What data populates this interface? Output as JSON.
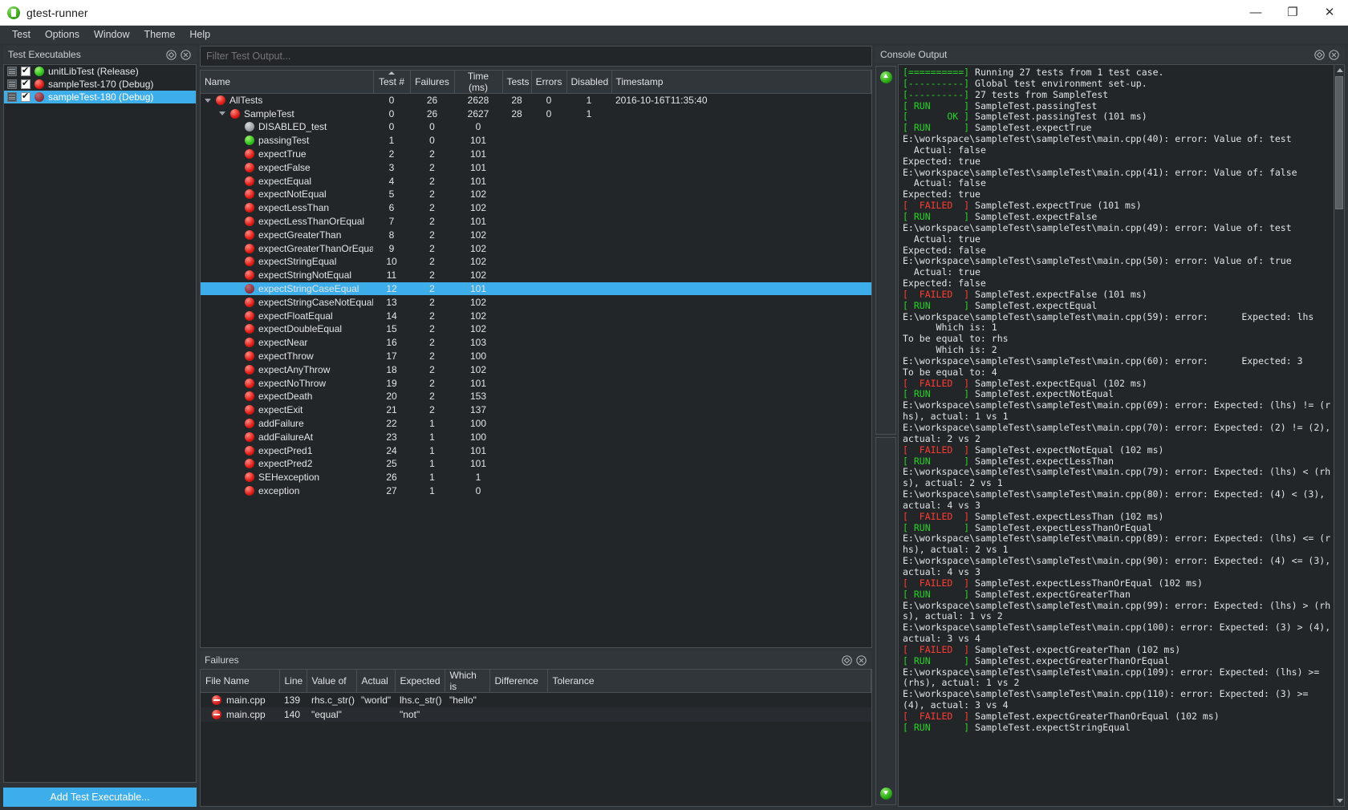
{
  "window": {
    "title": "gtest-runner",
    "app_icon": "gtest-runner-icon",
    "minimize": "—",
    "maximize": "❐",
    "close": "✕"
  },
  "menubar": {
    "items": [
      "Test",
      "Options",
      "Window",
      "Theme",
      "Help"
    ]
  },
  "test_executables": {
    "title": "Test Executables",
    "float_icon": "float-icon",
    "close_icon": "close-icon",
    "items": [
      {
        "name": "unitLibTest (Release)",
        "checked": true,
        "status": "green",
        "selected": false
      },
      {
        "name": "sampleTest-170 (Debug)",
        "checked": true,
        "status": "red",
        "selected": false
      },
      {
        "name": "sampleTest-180 (Debug)",
        "checked": true,
        "status": "dark-red",
        "selected": true
      }
    ],
    "add_button": "Add Test Executable..."
  },
  "filter": {
    "placeholder": "Filter Test Output...",
    "value": ""
  },
  "tests_tree": {
    "columns": [
      "Name",
      "Test #",
      "Failures",
      "Time (ms)",
      "Tests",
      "Errors",
      "Disabled",
      "Timestamp"
    ],
    "sorted_column": "Test #",
    "rows": [
      {
        "name": "AllTests",
        "indent": 0,
        "arrow": "open",
        "status": "red",
        "test_num": "0",
        "failures": "26",
        "time": "2628",
        "tests": "28",
        "errors": "0",
        "disabled": "1",
        "timestamp": "2016-10-16T11:35:40",
        "selected": false
      },
      {
        "name": "SampleTest",
        "indent": 1,
        "arrow": "open",
        "status": "red",
        "test_num": "0",
        "failures": "26",
        "time": "2627",
        "tests": "28",
        "errors": "0",
        "disabled": "1",
        "timestamp": "",
        "selected": false
      },
      {
        "name": "DISABLED_test",
        "indent": 2,
        "arrow": "none",
        "status": "grey",
        "test_num": "0",
        "failures": "0",
        "time": "0",
        "tests": "",
        "errors": "",
        "disabled": "",
        "timestamp": "",
        "selected": false
      },
      {
        "name": "passingTest",
        "indent": 2,
        "arrow": "none",
        "status": "green",
        "test_num": "1",
        "failures": "0",
        "time": "101",
        "tests": "",
        "errors": "",
        "disabled": "",
        "timestamp": "",
        "selected": false
      },
      {
        "name": "expectTrue",
        "indent": 2,
        "arrow": "none",
        "status": "red",
        "test_num": "2",
        "failures": "2",
        "time": "101",
        "tests": "",
        "errors": "",
        "disabled": "",
        "timestamp": "",
        "selected": false
      },
      {
        "name": "expectFalse",
        "indent": 2,
        "arrow": "none",
        "status": "red",
        "test_num": "3",
        "failures": "2",
        "time": "101",
        "tests": "",
        "errors": "",
        "disabled": "",
        "timestamp": "",
        "selected": false
      },
      {
        "name": "expectEqual",
        "indent": 2,
        "arrow": "none",
        "status": "red",
        "test_num": "4",
        "failures": "2",
        "time": "101",
        "tests": "",
        "errors": "",
        "disabled": "",
        "timestamp": "",
        "selected": false
      },
      {
        "name": "expectNotEqual",
        "indent": 2,
        "arrow": "none",
        "status": "red",
        "test_num": "5",
        "failures": "2",
        "time": "102",
        "tests": "",
        "errors": "",
        "disabled": "",
        "timestamp": "",
        "selected": false
      },
      {
        "name": "expectLessThan",
        "indent": 2,
        "arrow": "none",
        "status": "red",
        "test_num": "6",
        "failures": "2",
        "time": "102",
        "tests": "",
        "errors": "",
        "disabled": "",
        "timestamp": "",
        "selected": false
      },
      {
        "name": "expectLessThanOrEqual",
        "indent": 2,
        "arrow": "none",
        "status": "red",
        "test_num": "7",
        "failures": "2",
        "time": "101",
        "tests": "",
        "errors": "",
        "disabled": "",
        "timestamp": "",
        "selected": false
      },
      {
        "name": "expectGreaterThan",
        "indent": 2,
        "arrow": "none",
        "status": "red",
        "test_num": "8",
        "failures": "2",
        "time": "102",
        "tests": "",
        "errors": "",
        "disabled": "",
        "timestamp": "",
        "selected": false
      },
      {
        "name": "expectGreaterThanOrEqual",
        "indent": 2,
        "arrow": "none",
        "status": "red",
        "test_num": "9",
        "failures": "2",
        "time": "102",
        "tests": "",
        "errors": "",
        "disabled": "",
        "timestamp": "",
        "selected": false
      },
      {
        "name": "expectStringEqual",
        "indent": 2,
        "arrow": "none",
        "status": "red",
        "test_num": "10",
        "failures": "2",
        "time": "102",
        "tests": "",
        "errors": "",
        "disabled": "",
        "timestamp": "",
        "selected": false
      },
      {
        "name": "expectStringNotEqual",
        "indent": 2,
        "arrow": "none",
        "status": "red",
        "test_num": "11",
        "failures": "2",
        "time": "102",
        "tests": "",
        "errors": "",
        "disabled": "",
        "timestamp": "",
        "selected": false
      },
      {
        "name": "expectStringCaseEqual",
        "indent": 2,
        "arrow": "none",
        "status": "dark-red",
        "test_num": "12",
        "failures": "2",
        "time": "101",
        "tests": "",
        "errors": "",
        "disabled": "",
        "timestamp": "",
        "selected": true
      },
      {
        "name": "expectStringCaseNotEqual",
        "indent": 2,
        "arrow": "none",
        "status": "red",
        "test_num": "13",
        "failures": "2",
        "time": "102",
        "tests": "",
        "errors": "",
        "disabled": "",
        "timestamp": "",
        "selected": false
      },
      {
        "name": "expectFloatEqual",
        "indent": 2,
        "arrow": "none",
        "status": "red",
        "test_num": "14",
        "failures": "2",
        "time": "102",
        "tests": "",
        "errors": "",
        "disabled": "",
        "timestamp": "",
        "selected": false
      },
      {
        "name": "expectDoubleEqual",
        "indent": 2,
        "arrow": "none",
        "status": "red",
        "test_num": "15",
        "failures": "2",
        "time": "102",
        "tests": "",
        "errors": "",
        "disabled": "",
        "timestamp": "",
        "selected": false
      },
      {
        "name": "expectNear",
        "indent": 2,
        "arrow": "none",
        "status": "red",
        "test_num": "16",
        "failures": "2",
        "time": "103",
        "tests": "",
        "errors": "",
        "disabled": "",
        "timestamp": "",
        "selected": false
      },
      {
        "name": "expectThrow",
        "indent": 2,
        "arrow": "none",
        "status": "red",
        "test_num": "17",
        "failures": "2",
        "time": "100",
        "tests": "",
        "errors": "",
        "disabled": "",
        "timestamp": "",
        "selected": false
      },
      {
        "name": "expectAnyThrow",
        "indent": 2,
        "arrow": "none",
        "status": "red",
        "test_num": "18",
        "failures": "2",
        "time": "102",
        "tests": "",
        "errors": "",
        "disabled": "",
        "timestamp": "",
        "selected": false
      },
      {
        "name": "expectNoThrow",
        "indent": 2,
        "arrow": "none",
        "status": "red",
        "test_num": "19",
        "failures": "2",
        "time": "101",
        "tests": "",
        "errors": "",
        "disabled": "",
        "timestamp": "",
        "selected": false
      },
      {
        "name": "expectDeath",
        "indent": 2,
        "arrow": "none",
        "status": "red",
        "test_num": "20",
        "failures": "2",
        "time": "153",
        "tests": "",
        "errors": "",
        "disabled": "",
        "timestamp": "",
        "selected": false
      },
      {
        "name": "expectExit",
        "indent": 2,
        "arrow": "none",
        "status": "red",
        "test_num": "21",
        "failures": "2",
        "time": "137",
        "tests": "",
        "errors": "",
        "disabled": "",
        "timestamp": "",
        "selected": false
      },
      {
        "name": "addFailure",
        "indent": 2,
        "arrow": "none",
        "status": "red",
        "test_num": "22",
        "failures": "1",
        "time": "100",
        "tests": "",
        "errors": "",
        "disabled": "",
        "timestamp": "",
        "selected": false
      },
      {
        "name": "addFailureAt",
        "indent": 2,
        "arrow": "none",
        "status": "red",
        "test_num": "23",
        "failures": "1",
        "time": "100",
        "tests": "",
        "errors": "",
        "disabled": "",
        "timestamp": "",
        "selected": false
      },
      {
        "name": "expectPred1",
        "indent": 2,
        "arrow": "none",
        "status": "red",
        "test_num": "24",
        "failures": "1",
        "time": "101",
        "tests": "",
        "errors": "",
        "disabled": "",
        "timestamp": "",
        "selected": false
      },
      {
        "name": "expectPred2",
        "indent": 2,
        "arrow": "none",
        "status": "red",
        "test_num": "25",
        "failures": "1",
        "time": "101",
        "tests": "",
        "errors": "",
        "disabled": "",
        "timestamp": "",
        "selected": false
      },
      {
        "name": "SEHexception",
        "indent": 2,
        "arrow": "none",
        "status": "red",
        "test_num": "26",
        "failures": "1",
        "time": "1",
        "tests": "",
        "errors": "",
        "disabled": "",
        "timestamp": "",
        "selected": false
      },
      {
        "name": "exception",
        "indent": 2,
        "arrow": "none",
        "status": "red",
        "test_num": "27",
        "failures": "1",
        "time": "0",
        "tests": "",
        "errors": "",
        "disabled": "",
        "timestamp": "",
        "selected": false
      }
    ]
  },
  "failures": {
    "title": "Failures",
    "float_icon": "float-icon",
    "close_icon": "close-icon",
    "columns": [
      "File Name",
      "Line",
      "Value of",
      "Actual",
      "Expected",
      "Which is",
      "Difference",
      "Tolerance"
    ],
    "sorted_column": "File Name",
    "rows": [
      {
        "file": "main.cpp",
        "line": "139",
        "value_of": "rhs.c_str()",
        "actual": "\"world\"",
        "expected": "lhs.c_str()",
        "which_is": "\"hello\"",
        "difference": "",
        "tolerance": ""
      },
      {
        "file": "main.cpp",
        "line": "140",
        "value_of": "\"equal\"",
        "actual": "",
        "expected": "\"not\"",
        "which_is": "",
        "difference": "",
        "tolerance": ""
      }
    ]
  },
  "console": {
    "title": "Console Output",
    "float_icon": "float-icon",
    "close_icon": "close-icon",
    "prev_failure_icon": "arrow-up-icon",
    "next_failure_icon": "arrow-down-icon",
    "scroll_up_icon": "scroll-up-icon",
    "scroll_down_icon": "scroll-down-icon",
    "lines": [
      {
        "tag": "[==========]",
        "tag_color": "green",
        "text": " Running 27 tests from 1 test case."
      },
      {
        "tag": "[----------]",
        "tag_color": "green",
        "text": " Global test environment set-up."
      },
      {
        "tag": "[----------]",
        "tag_color": "green",
        "text": " 27 tests from SampleTest"
      },
      {
        "tag": "[ RUN      ]",
        "tag_color": "green",
        "text": " SampleTest.passingTest"
      },
      {
        "tag": "[       OK ]",
        "tag_color": "green",
        "text": " SampleTest.passingTest (101 ms)"
      },
      {
        "tag": "[ RUN      ]",
        "tag_color": "green",
        "text": " SampleTest.expectTrue"
      },
      {
        "tag": "",
        "tag_color": "",
        "text": "E:\\workspace\\sampleTest\\sampleTest\\main.cpp(40): error: Value of: test"
      },
      {
        "tag": "",
        "tag_color": "",
        "text": "  Actual: false"
      },
      {
        "tag": "",
        "tag_color": "",
        "text": "Expected: true"
      },
      {
        "tag": "",
        "tag_color": "",
        "text": "E:\\workspace\\sampleTest\\sampleTest\\main.cpp(41): error: Value of: false"
      },
      {
        "tag": "",
        "tag_color": "",
        "text": "  Actual: false"
      },
      {
        "tag": "",
        "tag_color": "",
        "text": "Expected: true"
      },
      {
        "tag": "[  FAILED  ]",
        "tag_color": "red",
        "text": " SampleTest.expectTrue (101 ms)"
      },
      {
        "tag": "[ RUN      ]",
        "tag_color": "green",
        "text": " SampleTest.expectFalse"
      },
      {
        "tag": "",
        "tag_color": "",
        "text": "E:\\workspace\\sampleTest\\sampleTest\\main.cpp(49): error: Value of: test"
      },
      {
        "tag": "",
        "tag_color": "",
        "text": "  Actual: true"
      },
      {
        "tag": "",
        "tag_color": "",
        "text": "Expected: false"
      },
      {
        "tag": "",
        "tag_color": "",
        "text": "E:\\workspace\\sampleTest\\sampleTest\\main.cpp(50): error: Value of: true"
      },
      {
        "tag": "",
        "tag_color": "",
        "text": "  Actual: true"
      },
      {
        "tag": "",
        "tag_color": "",
        "text": "Expected: false"
      },
      {
        "tag": "[  FAILED  ]",
        "tag_color": "red",
        "text": " SampleTest.expectFalse (101 ms)"
      },
      {
        "tag": "[ RUN      ]",
        "tag_color": "green",
        "text": " SampleTest.expectEqual"
      },
      {
        "tag": "",
        "tag_color": "",
        "text": "E:\\workspace\\sampleTest\\sampleTest\\main.cpp(59): error:      Expected: lhs"
      },
      {
        "tag": "",
        "tag_color": "",
        "text": "      Which is: 1"
      },
      {
        "tag": "",
        "tag_color": "",
        "text": "To be equal to: rhs"
      },
      {
        "tag": "",
        "tag_color": "",
        "text": "      Which is: 2"
      },
      {
        "tag": "",
        "tag_color": "",
        "text": "E:\\workspace\\sampleTest\\sampleTest\\main.cpp(60): error:      Expected: 3"
      },
      {
        "tag": "",
        "tag_color": "",
        "text": "To be equal to: 4"
      },
      {
        "tag": "[  FAILED  ]",
        "tag_color": "red",
        "text": " SampleTest.expectEqual (102 ms)"
      },
      {
        "tag": "[ RUN      ]",
        "tag_color": "green",
        "text": " SampleTest.expectNotEqual"
      },
      {
        "tag": "",
        "tag_color": "",
        "text": "E:\\workspace\\sampleTest\\sampleTest\\main.cpp(69): error: Expected: (lhs) != (rhs), actual: 1 vs 1"
      },
      {
        "tag": "",
        "tag_color": "",
        "text": "E:\\workspace\\sampleTest\\sampleTest\\main.cpp(70): error: Expected: (2) != (2), actual: 2 vs 2"
      },
      {
        "tag": "[  FAILED  ]",
        "tag_color": "red",
        "text": " SampleTest.expectNotEqual (102 ms)"
      },
      {
        "tag": "[ RUN      ]",
        "tag_color": "green",
        "text": " SampleTest.expectLessThan"
      },
      {
        "tag": "",
        "tag_color": "",
        "text": "E:\\workspace\\sampleTest\\sampleTest\\main.cpp(79): error: Expected: (lhs) < (rhs), actual: 2 vs 1"
      },
      {
        "tag": "",
        "tag_color": "",
        "text": "E:\\workspace\\sampleTest\\sampleTest\\main.cpp(80): error: Expected: (4) < (3), actual: 4 vs 3"
      },
      {
        "tag": "[  FAILED  ]",
        "tag_color": "red",
        "text": " SampleTest.expectLessThan (102 ms)"
      },
      {
        "tag": "[ RUN      ]",
        "tag_color": "green",
        "text": " SampleTest.expectLessThanOrEqual"
      },
      {
        "tag": "",
        "tag_color": "",
        "text": "E:\\workspace\\sampleTest\\sampleTest\\main.cpp(89): error: Expected: (lhs) <= (rhs), actual: 2 vs 1"
      },
      {
        "tag": "",
        "tag_color": "",
        "text": "E:\\workspace\\sampleTest\\sampleTest\\main.cpp(90): error: Expected: (4) <= (3), actual: 4 vs 3"
      },
      {
        "tag": "[  FAILED  ]",
        "tag_color": "red",
        "text": " SampleTest.expectLessThanOrEqual (102 ms)"
      },
      {
        "tag": "[ RUN      ]",
        "tag_color": "green",
        "text": " SampleTest.expectGreaterThan"
      },
      {
        "tag": "",
        "tag_color": "",
        "text": "E:\\workspace\\sampleTest\\sampleTest\\main.cpp(99): error: Expected: (lhs) > (rhs), actual: 1 vs 2"
      },
      {
        "tag": "",
        "tag_color": "",
        "text": "E:\\workspace\\sampleTest\\sampleTest\\main.cpp(100): error: Expected: (3) > (4), actual: 3 vs 4"
      },
      {
        "tag": "[  FAILED  ]",
        "tag_color": "red",
        "text": " SampleTest.expectGreaterThan (102 ms)"
      },
      {
        "tag": "[ RUN      ]",
        "tag_color": "green",
        "text": " SampleTest.expectGreaterThanOrEqual"
      },
      {
        "tag": "",
        "tag_color": "",
        "text": "E:\\workspace\\sampleTest\\sampleTest\\main.cpp(109): error: Expected: (lhs) >= (rhs), actual: 1 vs 2"
      },
      {
        "tag": "",
        "tag_color": "",
        "text": "E:\\workspace\\sampleTest\\sampleTest\\main.cpp(110): error: Expected: (3) >= (4), actual: 3 vs 4"
      },
      {
        "tag": "[  FAILED  ]",
        "tag_color": "red",
        "text": " SampleTest.expectGreaterThanOrEqual (102 ms)"
      },
      {
        "tag": "[ RUN      ]",
        "tag_color": "green",
        "text": " SampleTest.expectStringEqual"
      }
    ]
  }
}
